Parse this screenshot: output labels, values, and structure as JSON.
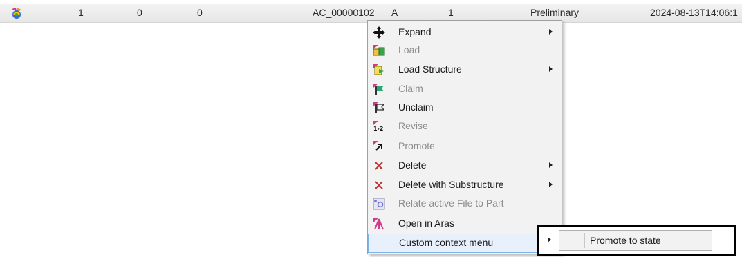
{
  "row": {
    "icon": "app-logo-icon",
    "c1": "1",
    "c2": "0",
    "c3": "0",
    "number": "AC_00000102",
    "revision": "A",
    "generation": "1",
    "state": "Preliminary",
    "date": "2024-08-13T14:06:1"
  },
  "menu": {
    "items": [
      {
        "label": "Expand",
        "icon": "expand-icon",
        "enabled": true,
        "submenu": true
      },
      {
        "label": "Load",
        "icon": "load-icon",
        "enabled": false,
        "submenu": false
      },
      {
        "label": "Load Structure",
        "icon": "load-structure-icon",
        "enabled": true,
        "submenu": true
      },
      {
        "label": "Claim",
        "icon": "claim-flag-icon",
        "enabled": false,
        "submenu": false
      },
      {
        "label": "Unclaim",
        "icon": "unclaim-flag-icon",
        "enabled": true,
        "submenu": false
      },
      {
        "label": "Revise",
        "icon": "revise-icon",
        "enabled": false,
        "submenu": false
      },
      {
        "label": "Promote",
        "icon": "promote-icon",
        "enabled": false,
        "submenu": false
      },
      {
        "label": "Delete",
        "icon": "delete-icon",
        "enabled": true,
        "submenu": true
      },
      {
        "label": "Delete with Substructure",
        "icon": "delete-substructure-icon",
        "enabled": true,
        "submenu": true
      },
      {
        "label": "Relate active File to Part",
        "icon": "relate-file-icon",
        "enabled": false,
        "submenu": false
      },
      {
        "label": "Open in Aras",
        "icon": "aras-icon",
        "enabled": true,
        "submenu": false
      },
      {
        "label": "Custom context menu",
        "icon": "",
        "enabled": true,
        "submenu": true,
        "highlighted": true
      }
    ]
  },
  "submenu": {
    "items": [
      {
        "label": "Promote to state"
      }
    ]
  },
  "colors": {
    "highlight_bg": "#e7f0fb",
    "highlight_border": "#7eb4ea",
    "disabled_text": "#8c8c8c",
    "menu_bg": "#f2f2f2"
  }
}
